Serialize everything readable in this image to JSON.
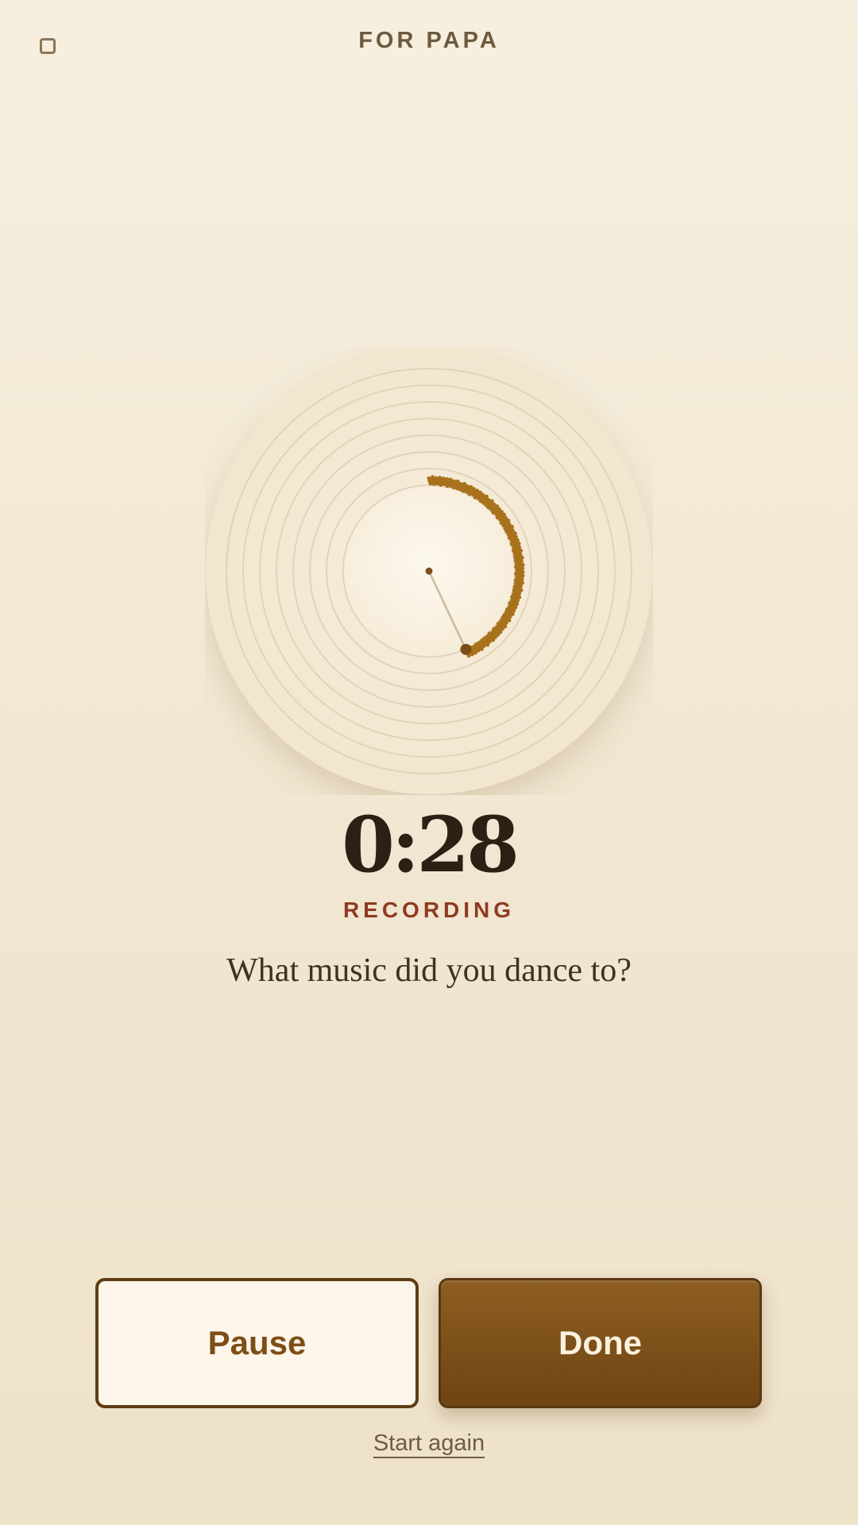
{
  "header": {
    "title": "FOR PAPA",
    "stop_icon": "stop-square-icon"
  },
  "recorder": {
    "timer": "0:28",
    "status": "RECORDING",
    "progress_fraction": 0.43,
    "accent_color": "#a8711b",
    "status_color": "#8f3a22"
  },
  "prompt": {
    "question": "What music did you dance to?"
  },
  "actions": {
    "pause_label": "Pause",
    "done_label": "Done",
    "restart_label": "Start again"
  }
}
